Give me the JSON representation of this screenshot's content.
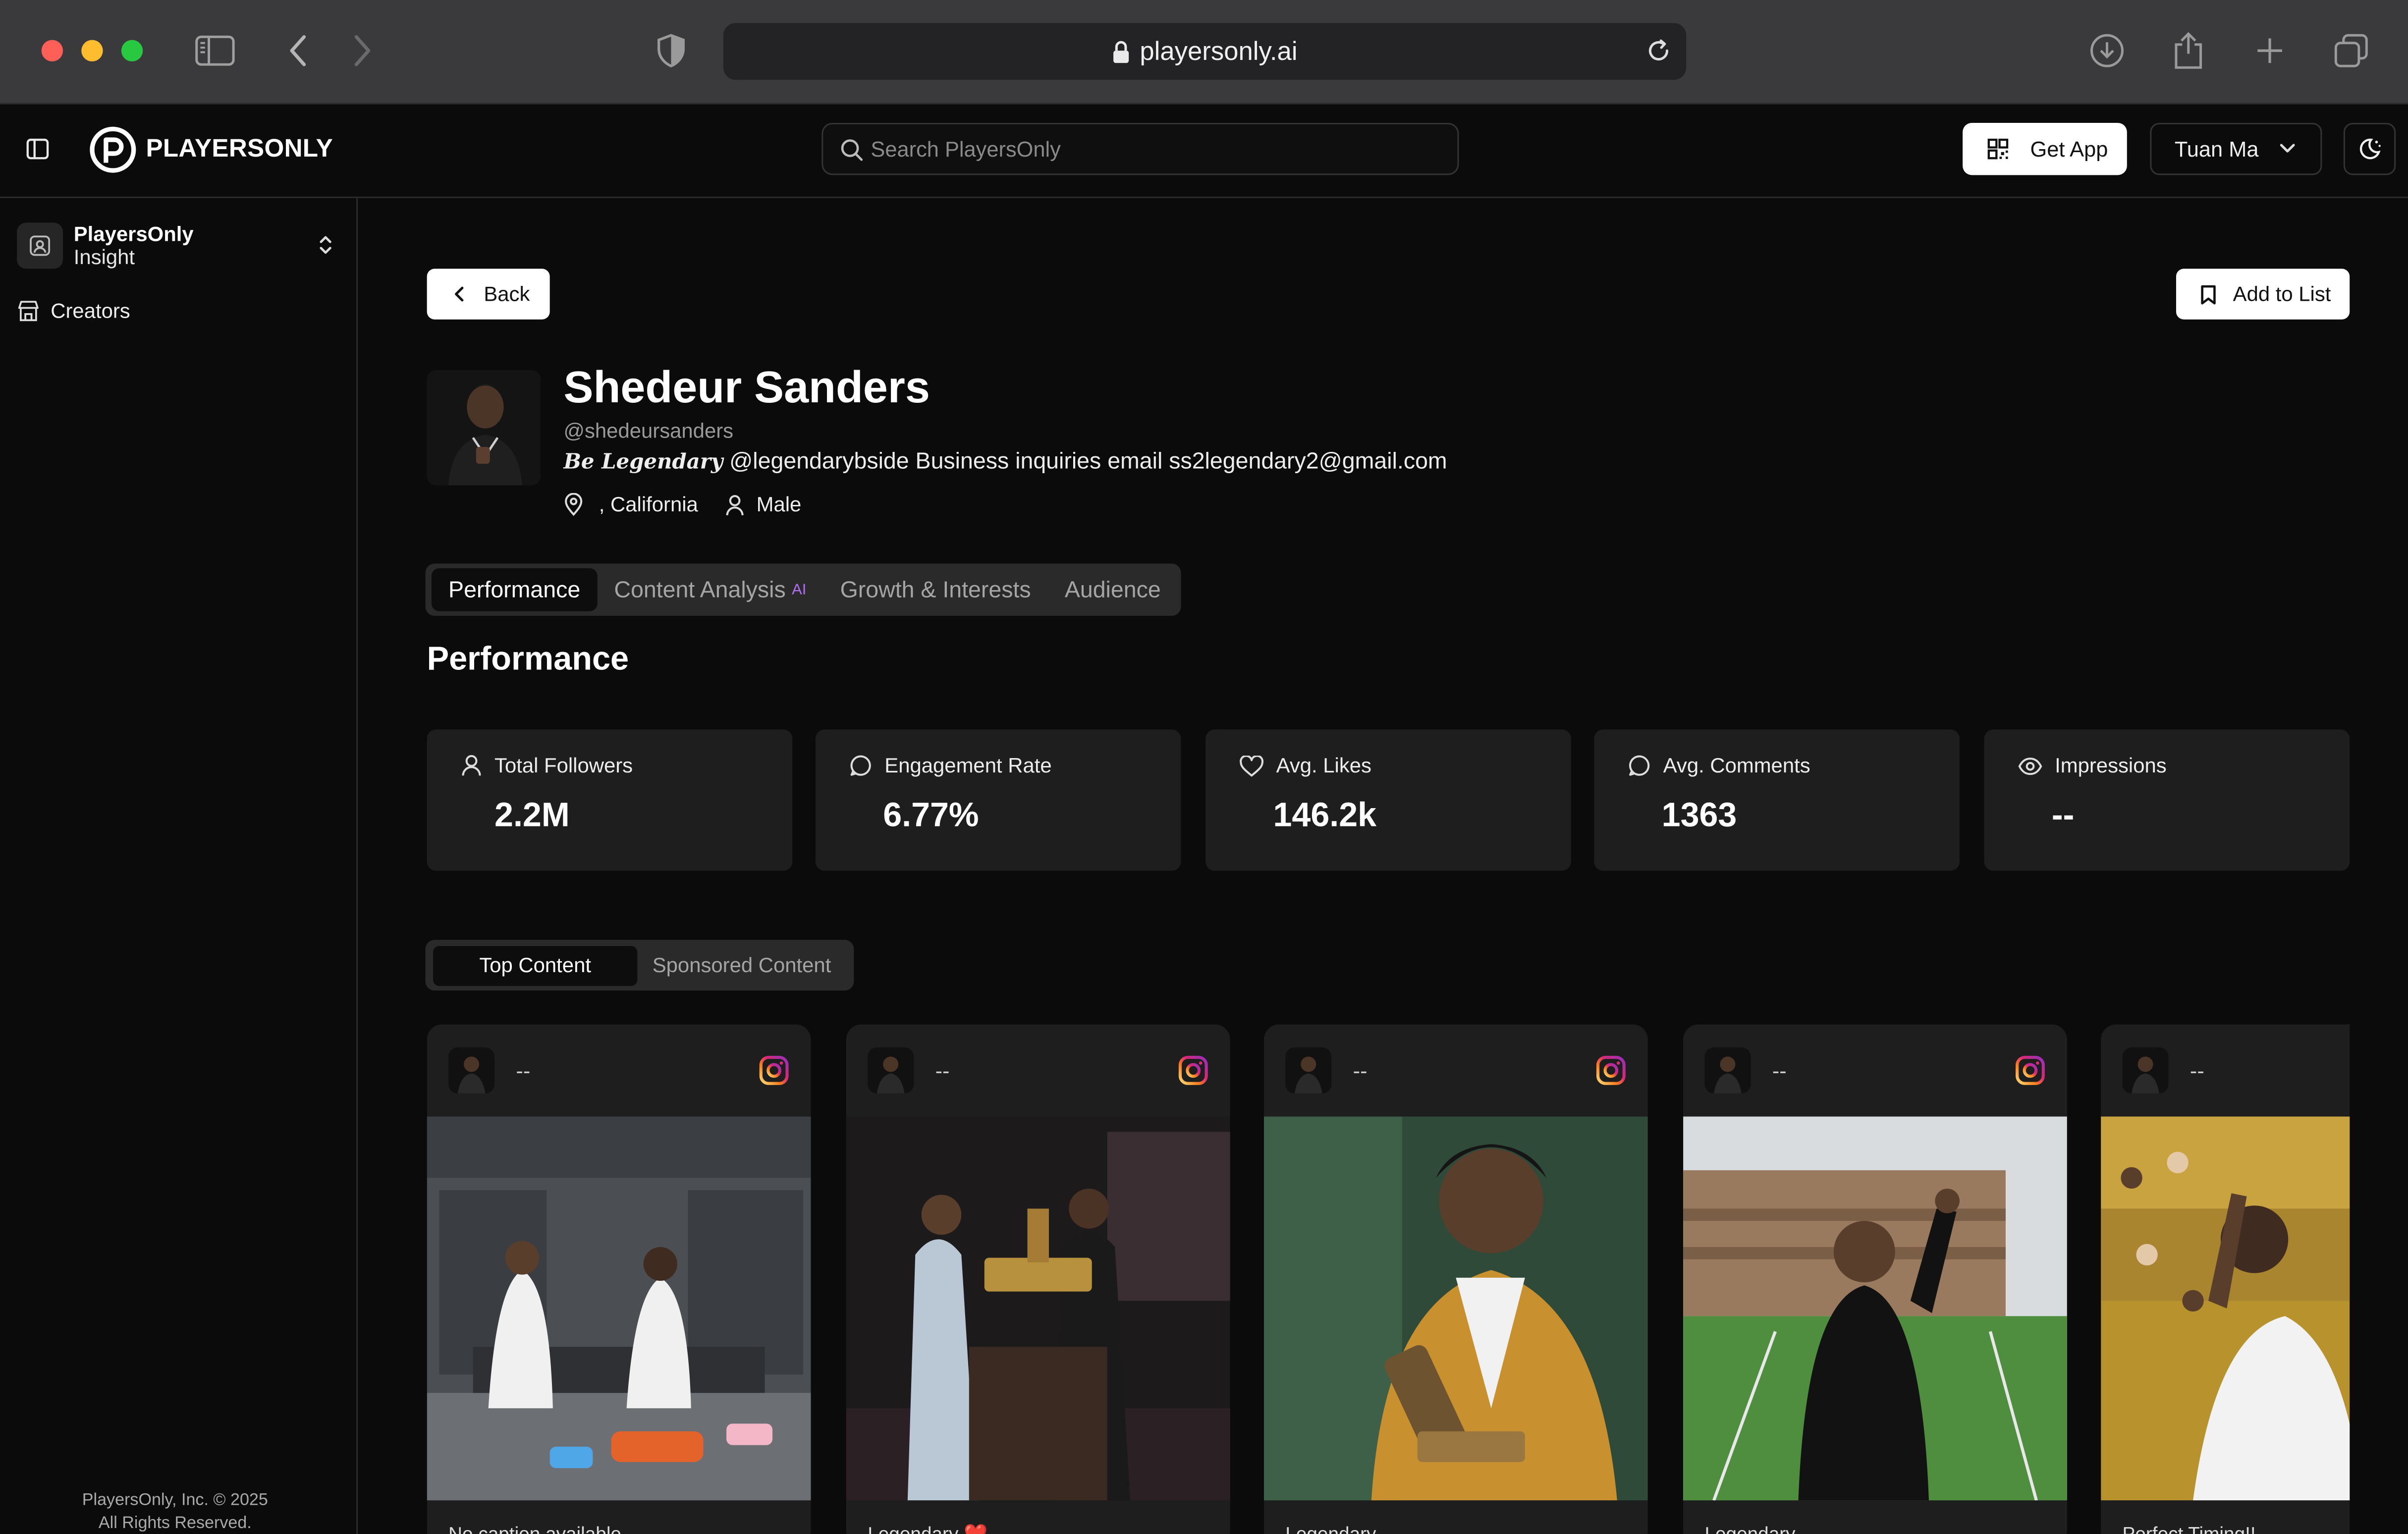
{
  "browser": {
    "url": "playersonly.ai"
  },
  "header": {
    "brand": "PLAYERSONLY",
    "search_placeholder": "Search PlayersOnly",
    "get_app_label": "Get App",
    "user_name": "Tuan Ma"
  },
  "sidebar": {
    "workspace_name": "PlayersOnly",
    "workspace_sub": "Insight",
    "items": [
      {
        "label": "Creators",
        "icon": "store-icon"
      }
    ],
    "footer_line1": "PlayersOnly, Inc. © 2025",
    "footer_line2": "All Rights Reserved."
  },
  "profile": {
    "back_label": "Back",
    "add_to_list_label": "Add to List",
    "name": "Shedeur Sanders",
    "handle": "@shedeursanders",
    "bio_fancy": "𝑩𝒆 𝑳𝒆𝒈𝒆𝒏𝒅𝒂𝒓𝒚",
    "bio_rest": " @legendarybside Business inquiries email ss2legendary2@gmail.com",
    "location": ", California",
    "gender": "Male"
  },
  "tabs": [
    {
      "label": "Performance",
      "active": true
    },
    {
      "label": "Content Analysis",
      "badge": "AI",
      "active": false
    },
    {
      "label": "Growth & Interests",
      "active": false
    },
    {
      "label": "Audience",
      "active": false
    }
  ],
  "performance": {
    "title": "Performance",
    "stats": [
      {
        "label": "Total Followers",
        "value": "2.2M",
        "icon": "user-icon"
      },
      {
        "label": "Engagement Rate",
        "value": "6.77%",
        "icon": "message-icon"
      },
      {
        "label": "Avg. Likes",
        "value": "146.2k",
        "icon": "heart-icon"
      },
      {
        "label": "Avg. Comments",
        "value": "1363",
        "icon": "comment-icon"
      },
      {
        "label": "Impressions",
        "value": "--",
        "icon": "eye-icon"
      }
    ]
  },
  "content_tabs": [
    {
      "label": "Top Content",
      "active": true
    },
    {
      "label": "Sponsored Content",
      "active": false
    }
  ],
  "posts": [
    {
      "author": "--",
      "platform": "instagram",
      "caption": "No caption available"
    },
    {
      "author": "--",
      "platform": "instagram",
      "caption": "Legendary ❤️"
    },
    {
      "author": "--",
      "platform": "instagram",
      "caption": "Legendary"
    },
    {
      "author": "--",
      "platform": "instagram",
      "caption": "Legendary"
    },
    {
      "author": "--",
      "platform": "instagram",
      "caption": "Perfect Timing!!"
    }
  ],
  "colors": {
    "background": "#0b0b0b",
    "card": "#1e1e1e",
    "ai_badge": "#b26ef5",
    "instagram_gradient": [
      "#feda75",
      "#d62976",
      "#962fbf",
      "#4f5bd5"
    ]
  }
}
